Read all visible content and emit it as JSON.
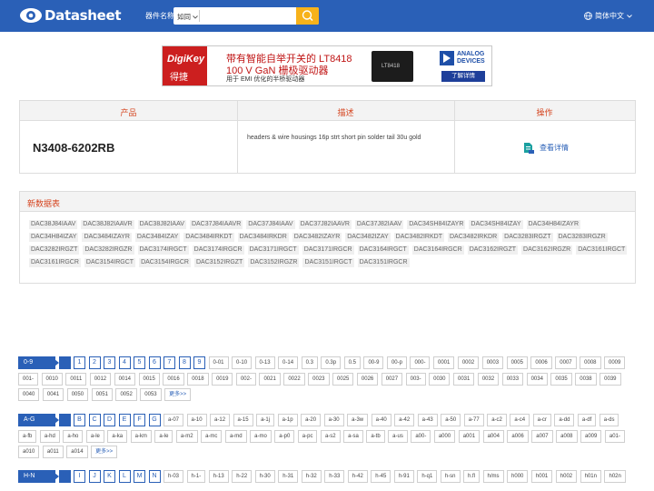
{
  "header": {
    "logo_text": "Datasheet",
    "search_label": "器件名称",
    "search_mode": "如同",
    "search_placeholder": "",
    "language": "简体中文"
  },
  "ad": {
    "brand": "DigiKey",
    "brand_sub": "得捷",
    "line1": "带有智能自举开关的 LT8418",
    "line2": "100 V GaN 栅极驱动器",
    "line3": "用于 EMI 优化的半桥驱动器",
    "chip_label": "LT8418",
    "adi_line1": "ANALOG",
    "adi_line2": "DEVICES",
    "cta": "了解详情"
  },
  "product_table": {
    "headers": {
      "product": "产品",
      "description": "描述",
      "action": "操作"
    },
    "part_number": "N3408-6202RB",
    "description": "headers & wire housings 16p strt short pin solder tail 30u gold",
    "action_label": "查看详情"
  },
  "new_datasheets": {
    "title": "新数据表",
    "items": [
      "DAC38J84IAAV",
      "DAC38J82IAAVR",
      "DAC38J82IAAV",
      "DAC37J84IAAVR",
      "DAC37J84IAAV",
      "DAC37J82IAAVR",
      "DAC37J82IAAV",
      "DAC34SH84IZAYR",
      "DAC34SH84IZAY",
      "DAC34H84IZAYR",
      "DAC34H84IZAY",
      "DAC3484IZAYR",
      "DAC3484IZAY",
      "DAC3484IRKDT",
      "DAC3484IRKDR",
      "DAC3482IZAYR",
      "DAC3482IZAY",
      "DAC3482IRKDT",
      "DAC3482IRKDR",
      "DAC3283IRGZT",
      "DAC3283IRGZR",
      "DAC3282IRGZT",
      "DAC3282IRGZR",
      "DAC3174IRGCT",
      "DAC3174IRGCR",
      "DAC3171IRGCT",
      "DAC3171IRGCR",
      "DAC3164IRGCT",
      "DAC3164IRGCR",
      "DAC3162IRGZT",
      "DAC3162IRGZR",
      "DAC3161IRGCT",
      "DAC3161IRGCR",
      "DAC3154IRGCT",
      "DAC3154IRGCR",
      "DAC3152IRGZT",
      "DAC3152IRGZR",
      "DAC3151IRGCT",
      "DAC3151IRGCR"
    ]
  },
  "index_sections": [
    {
      "label": "0-9",
      "letters": [
        "0",
        "1",
        "2",
        "3",
        "4",
        "5",
        "6",
        "7",
        "8",
        "9"
      ],
      "active": "0",
      "tags": [
        "0-01",
        "0-10",
        "0-13",
        "0-14",
        "0.3",
        "0.3p",
        "0.5",
        "00-9",
        "00-p",
        "000-",
        "0001",
        "0002",
        "0003",
        "0005",
        "0006",
        "0007",
        "0008",
        "0009",
        "001-",
        "0010",
        "0011",
        "0012",
        "0014",
        "0015",
        "0016",
        "0018",
        "0019",
        "002-",
        "0021",
        "0022",
        "0023",
        "0025",
        "0026",
        "0027",
        "003-",
        "0030",
        "0031",
        "0032",
        "0033",
        "0034",
        "0035",
        "0038",
        "0039",
        "0040",
        "0041",
        "0050",
        "0051",
        "0052",
        "0053"
      ],
      "more": "更多>>"
    },
    {
      "label": "A-G",
      "letters": [
        "A",
        "B",
        "C",
        "D",
        "E",
        "F",
        "G"
      ],
      "active": "A",
      "tags": [
        "a-07",
        "a-10",
        "a-12",
        "a-15",
        "a-1j",
        "a-1p",
        "a-20",
        "a-30",
        "a-3w",
        "a-40",
        "a-42",
        "a-43",
        "a-50",
        "a-77",
        "a-c2",
        "a-c4",
        "a-cr",
        "a-dd",
        "a-df",
        "a-ds",
        "a-fb",
        "a-hd",
        "a-ho",
        "a-le",
        "a-ka",
        "a-km",
        "a-le",
        "a-m2",
        "a-mc",
        "a-md",
        "a-mo",
        "a-p0",
        "a-pc",
        "a-s2",
        "a-sa",
        "a-tb",
        "a-us",
        "a00-",
        "a000",
        "a001",
        "a004",
        "a006",
        "a007",
        "a008",
        "a009",
        "a01-",
        "a010",
        "a011",
        "a014"
      ],
      "more": "更多>>"
    },
    {
      "label": "H-N",
      "letters": [
        "H",
        "I",
        "J",
        "K",
        "L",
        "M",
        "N"
      ],
      "active": "H",
      "tags": [
        "h-03",
        "h-1-",
        "h-13",
        "h-22",
        "h-30",
        "h-31",
        "h-32",
        "h-33",
        "h-42",
        "h-45",
        "h-91",
        "h-q1",
        "h-sn",
        "h.fl",
        "h/ms",
        "h000",
        "h001",
        "h002",
        "h01n",
        "h02n"
      ],
      "more": ""
    }
  ],
  "colors": {
    "brand_blue": "#2a60b7",
    "accent_orange": "#d5441f",
    "search_yellow": "#f7b21a"
  }
}
